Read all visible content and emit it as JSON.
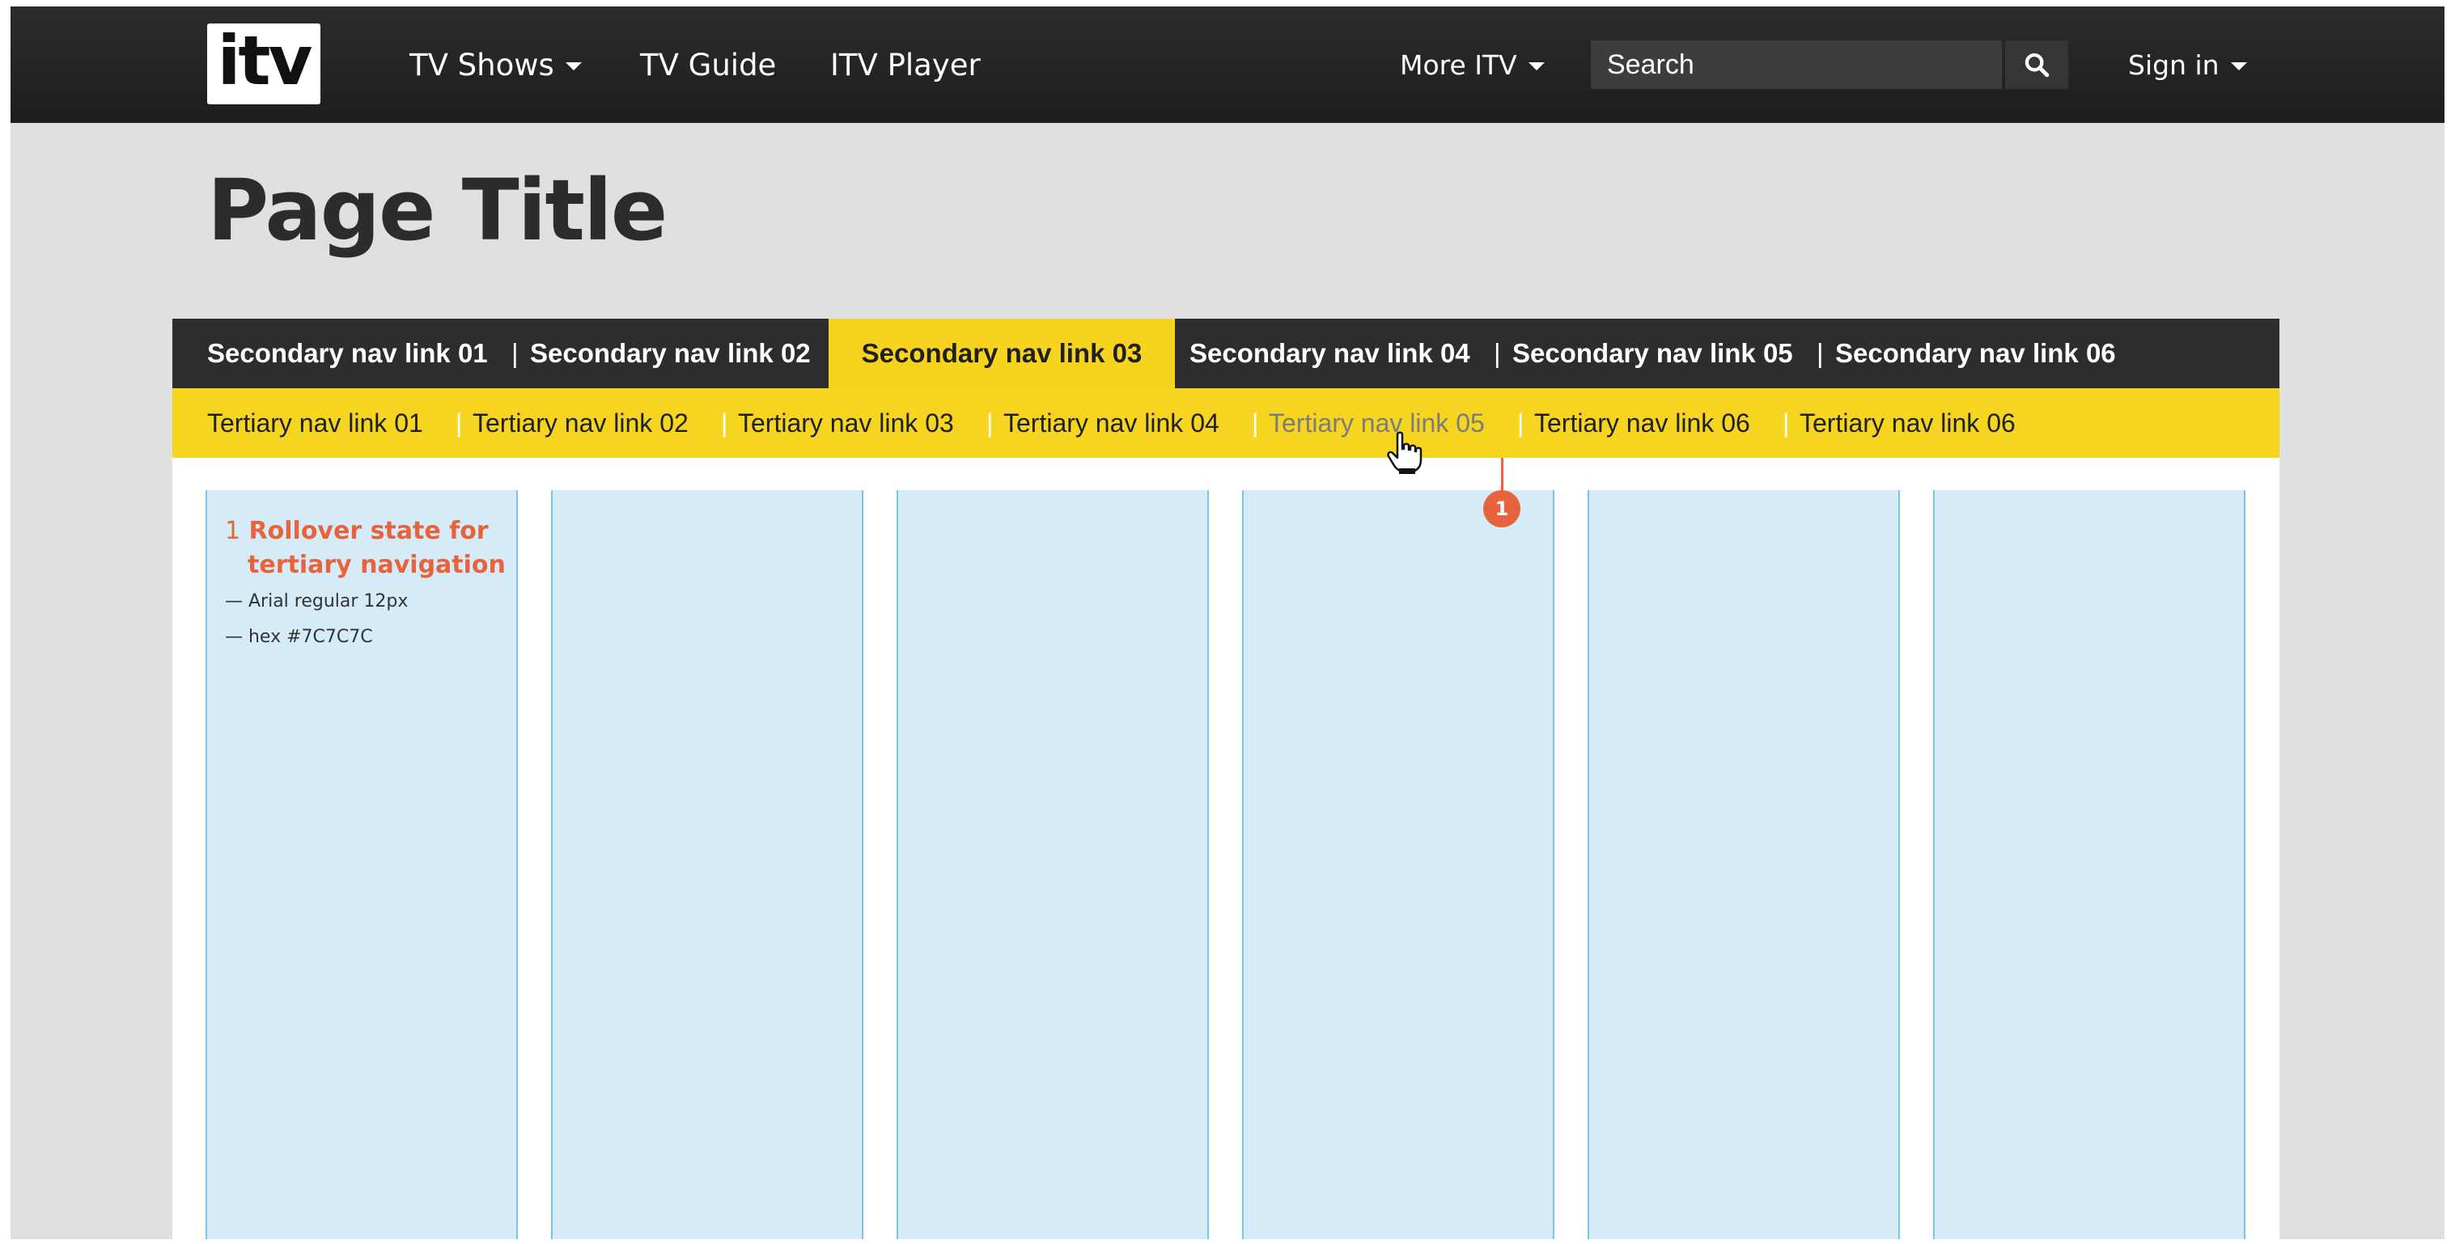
{
  "header": {
    "logo_text": "itv",
    "nav": [
      {
        "label": "TV Shows",
        "has_dropdown": true
      },
      {
        "label": "TV Guide",
        "has_dropdown": false
      },
      {
        "label": "ITV Player",
        "has_dropdown": false
      }
    ],
    "more_label": "More ITV",
    "search_placeholder": "Search",
    "sign_in_label": "Sign in"
  },
  "page_title": "Page Title",
  "secondary_nav": {
    "separator": "|",
    "active_index": 2,
    "items": [
      "Secondary nav link 01",
      "Secondary nav link 02",
      "Secondary nav link 03",
      "Secondary nav link 04",
      "Secondary nav link 05",
      "Secondary nav link 06"
    ]
  },
  "tertiary_nav": {
    "separator": "|",
    "hover_index": 4,
    "items": [
      "Tertiary nav link 01",
      "Tertiary nav link 02",
      "Tertiary nav link 03",
      "Tertiary nav link 04",
      "Tertiary nav link 05",
      "Tertiary nav link 06",
      "Tertiary nav link 06"
    ]
  },
  "annotation": {
    "number": "1",
    "title_line1": "Rollover state for",
    "title_line2": "tertiary navigation",
    "notes": [
      "— Arial regular 12px",
      "— hex #7C7C7C"
    ]
  },
  "colors": {
    "header_bg": "#222222",
    "accent_yellow": "#F5D51F",
    "annotation_orange": "#E8633B",
    "hover_text": "#7C7C7C",
    "grid_column": "#D5EBF7"
  },
  "icons": {
    "search": "search-icon",
    "caret": "caret-down-icon",
    "cursor": "hand-pointer-icon"
  }
}
